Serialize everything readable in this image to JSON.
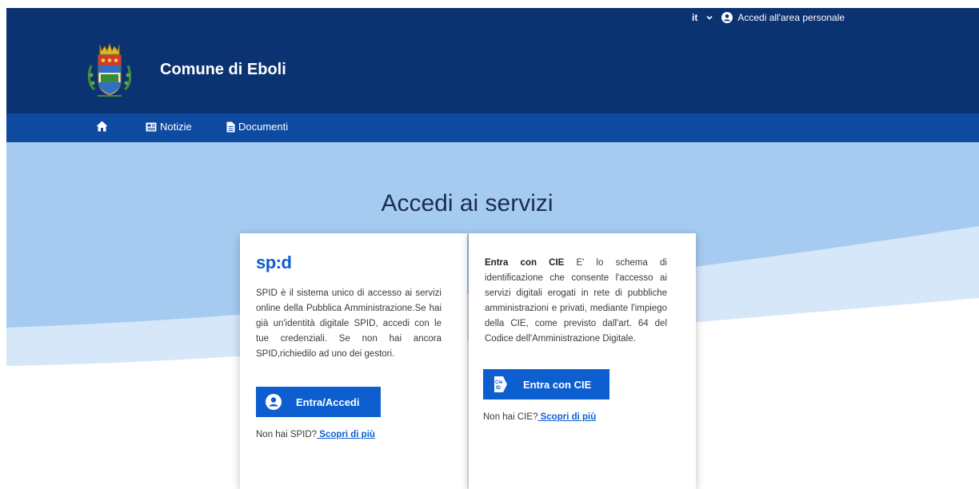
{
  "header": {
    "language": "it",
    "login_label": "Accedi all'area personale",
    "site_title": "Comune di Eboli"
  },
  "nav": {
    "items": [
      {
        "label": "",
        "icon": "home-icon"
      },
      {
        "label": "Notizie",
        "icon": "newspaper-icon"
      },
      {
        "label": "Documenti",
        "icon": "document-icon"
      }
    ]
  },
  "main": {
    "title": "Accedi ai servizi"
  },
  "spid": {
    "logo": "sp:d",
    "description": "SPID è il sistema unico di accesso ai servizi online della Pubblica Amministrazione.Se hai già un'identità digitale SPID, accedi con le tue credenziali. Se non hai ancora SPID,richiedilo ad uno dei gestori.",
    "button_label": "Entra/Accedi",
    "help_text": "Non hai SPID?",
    "help_link": " Scopri di più"
  },
  "cie": {
    "title_bold": "Entra con CIE",
    "description": " E' lo schema di identificazione che consente l'accesso ai servizi digitali erogati in rete di pubbliche amministrazioni e privati, mediante l'impiego della CIE, come previsto dall'art. 64 del Codice dell'Amministrazione Digitale.",
    "button_label": "Entra con CIE",
    "help_text": "Non hai CIE?",
    "help_link": " Scopri di più"
  },
  "colors": {
    "header": "#0b3271",
    "nav": "#0d4aa0",
    "accent": "#0d5fd0",
    "hero": "#a6cbf1"
  }
}
